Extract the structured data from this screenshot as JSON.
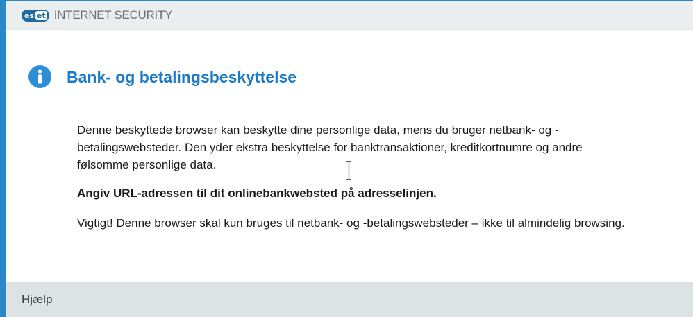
{
  "app": {
    "logo_text_part1": "es",
    "logo_text_part2": "et",
    "product_name": "INTERNET SECURITY"
  },
  "header": {
    "icon": "info-icon",
    "title": "Bank- og betalingsbeskyttelse"
  },
  "body": {
    "paragraph1": "Denne beskyttede browser kan beskytte dine personlige data, mens du bruger netbank- og -betalingswebsteder. Den yder ekstra beskyttelse for banktransaktioner, kreditkortnumre og andre følsomme personlige data.",
    "paragraph2": "Angiv URL-adressen til dit onlinebankwebsted på adresselinjen.",
    "paragraph3": "Vigtigt! Denne browser skal kun bruges til netbank- og -betalingswebsteder – ikke til almindelig browsing."
  },
  "footer": {
    "help_label": "Hjælp"
  },
  "colors": {
    "accent": "#1c7bc4",
    "border": "#2b88c8",
    "footer_bg": "#dde2e4"
  }
}
